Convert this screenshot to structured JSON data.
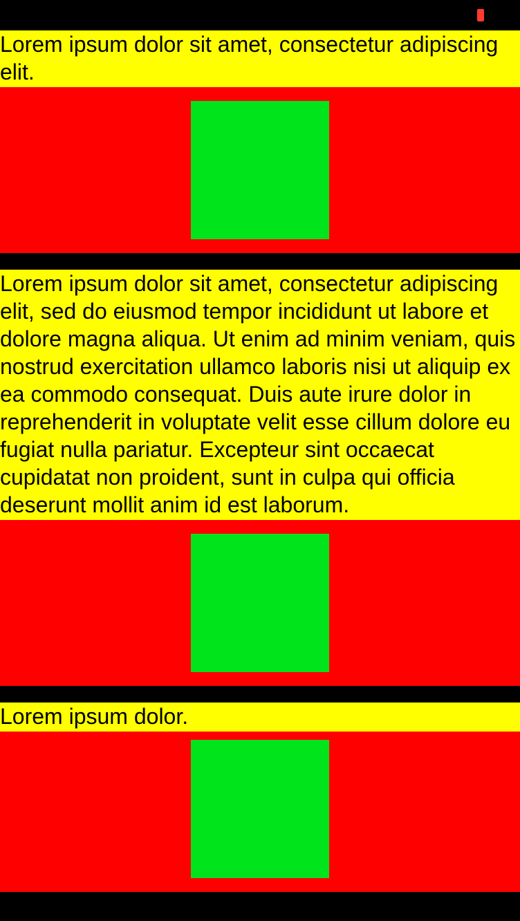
{
  "cells": [
    {
      "text": "Lorem ipsum dolor sit amet, consectetur adipiscing elit."
    },
    {
      "text": "Lorem ipsum dolor sit amet, consectetur adipiscing elit, sed do eiusmod tempor incididunt ut labore et dolore magna aliqua. Ut enim ad minim veniam, quis nostrud exercitation ullamco laboris nisi ut aliquip ex ea commodo consequat. Duis aute irure dolor in reprehenderit in voluptate velit esse cillum dolore eu fugiat nulla pariatur. Excepteur sint occaecat cupidatat non proident, sunt in culpa qui officia deserunt mollit anim id est laborum."
    },
    {
      "text": "Lorem ipsum dolor."
    }
  ],
  "colors": {
    "text_bg": "#ffff00",
    "image_bg": "#ff0000",
    "inner_square": "#00e41b",
    "page_bg": "#000000",
    "battery": "#ff3b30"
  }
}
